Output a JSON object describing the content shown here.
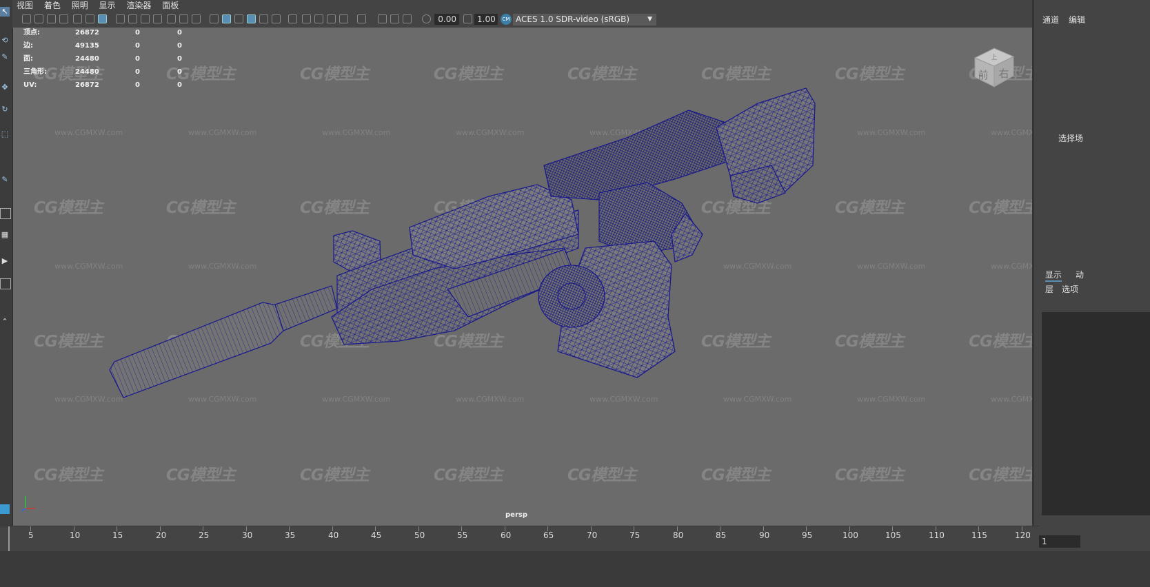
{
  "menu": [
    "视图",
    "着色",
    "照明",
    "显示",
    "渲染器",
    "面板"
  ],
  "toolbar": {
    "exposure_value": "0.00",
    "gamma_value": "1.00",
    "colorspace_badge": "CM",
    "colorspace": "ACES 1.0 SDR-video (sRGB)"
  },
  "hud_stats": [
    {
      "label": "顶点:",
      "v1": "26872",
      "v2": "0",
      "v3": "0"
    },
    {
      "label": "边:",
      "v1": "49135",
      "v2": "0",
      "v3": "0"
    },
    {
      "label": "面:",
      "v1": "24480",
      "v2": "0",
      "v3": "0"
    },
    {
      "label": "三角形:",
      "v1": "24480",
      "v2": "0",
      "v3": "0"
    },
    {
      "label": "UV:",
      "v1": "26872",
      "v2": "0",
      "v3": "0"
    }
  ],
  "watermark": {
    "logo": "CG模型主",
    "url": "www.CGMXW.com"
  },
  "viewcube": {
    "front": "前",
    "right": "右",
    "top": "上"
  },
  "camera_label": "persp",
  "right_panel": {
    "tab_channels": "通道",
    "tab_edit": "编辑",
    "select_hint": "选择场",
    "tab_display": "显示",
    "tab_anim": "动",
    "layers_menu": "层",
    "options_menu": "选项"
  },
  "timeline": {
    "ticks": [
      "5",
      "10",
      "15",
      "20",
      "25",
      "30",
      "35",
      "40",
      "45",
      "50",
      "55",
      "60",
      "65",
      "70",
      "75",
      "80",
      "85",
      "90",
      "95",
      "100",
      "105",
      "110",
      "115",
      "120"
    ],
    "current_frame": "1"
  },
  "colors": {
    "wireframe": "#1a1a8c",
    "viewport_bg": "#6b6b6b",
    "accent": "#5a8fb5"
  }
}
